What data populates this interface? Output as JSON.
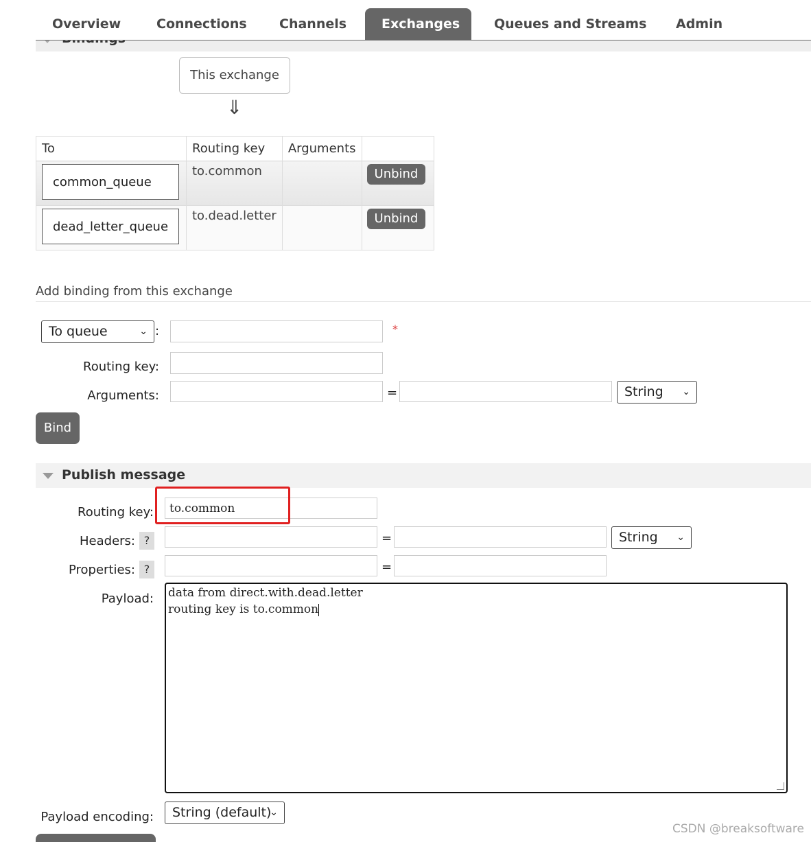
{
  "nav": {
    "tabs": [
      {
        "label": "Overview"
      },
      {
        "label": "Connections"
      },
      {
        "label": "Channels"
      },
      {
        "label": "Exchanges"
      },
      {
        "label": "Queues and Streams"
      },
      {
        "label": "Admin"
      }
    ],
    "active_tab": "Exchanges"
  },
  "bindings": {
    "section_title": "Bindings",
    "source_label": "This exchange",
    "arrow": "⇓",
    "columns": [
      "To",
      "Routing key",
      "Arguments",
      ""
    ],
    "rows": [
      {
        "to": "common_queue",
        "routing_key": "to.common",
        "arguments": "",
        "action": "Unbind"
      },
      {
        "to": "dead_letter_queue",
        "routing_key": "to.dead.letter",
        "arguments": "",
        "action": "Unbind"
      }
    ]
  },
  "add_binding": {
    "title": "Add binding from this exchange",
    "destination_type": "To queue",
    "required_mark": "*",
    "colon": ":",
    "routing_key_label": "Routing key:",
    "arguments_label": "Arguments:",
    "equals": "=",
    "arg_type": "String",
    "bind_button": "Bind"
  },
  "publish": {
    "title": "Publish message",
    "routing_key_label": "Routing key:",
    "routing_key_value": "to.common",
    "headers_label": "Headers:",
    "properties_label": "Properties:",
    "help": "?",
    "equals": "=",
    "header_type": "String",
    "payload_label": "Payload:",
    "payload_line1": "data from direct.with.dead.letter",
    "payload_line2": "routing key is to.common",
    "payload_encoding_label": "Payload encoding:",
    "payload_encoding": "String (default)"
  },
  "watermark": "CSDN @breaksoftware",
  "colors": {
    "tab_active": "#666666",
    "highlight": "#e02020"
  }
}
